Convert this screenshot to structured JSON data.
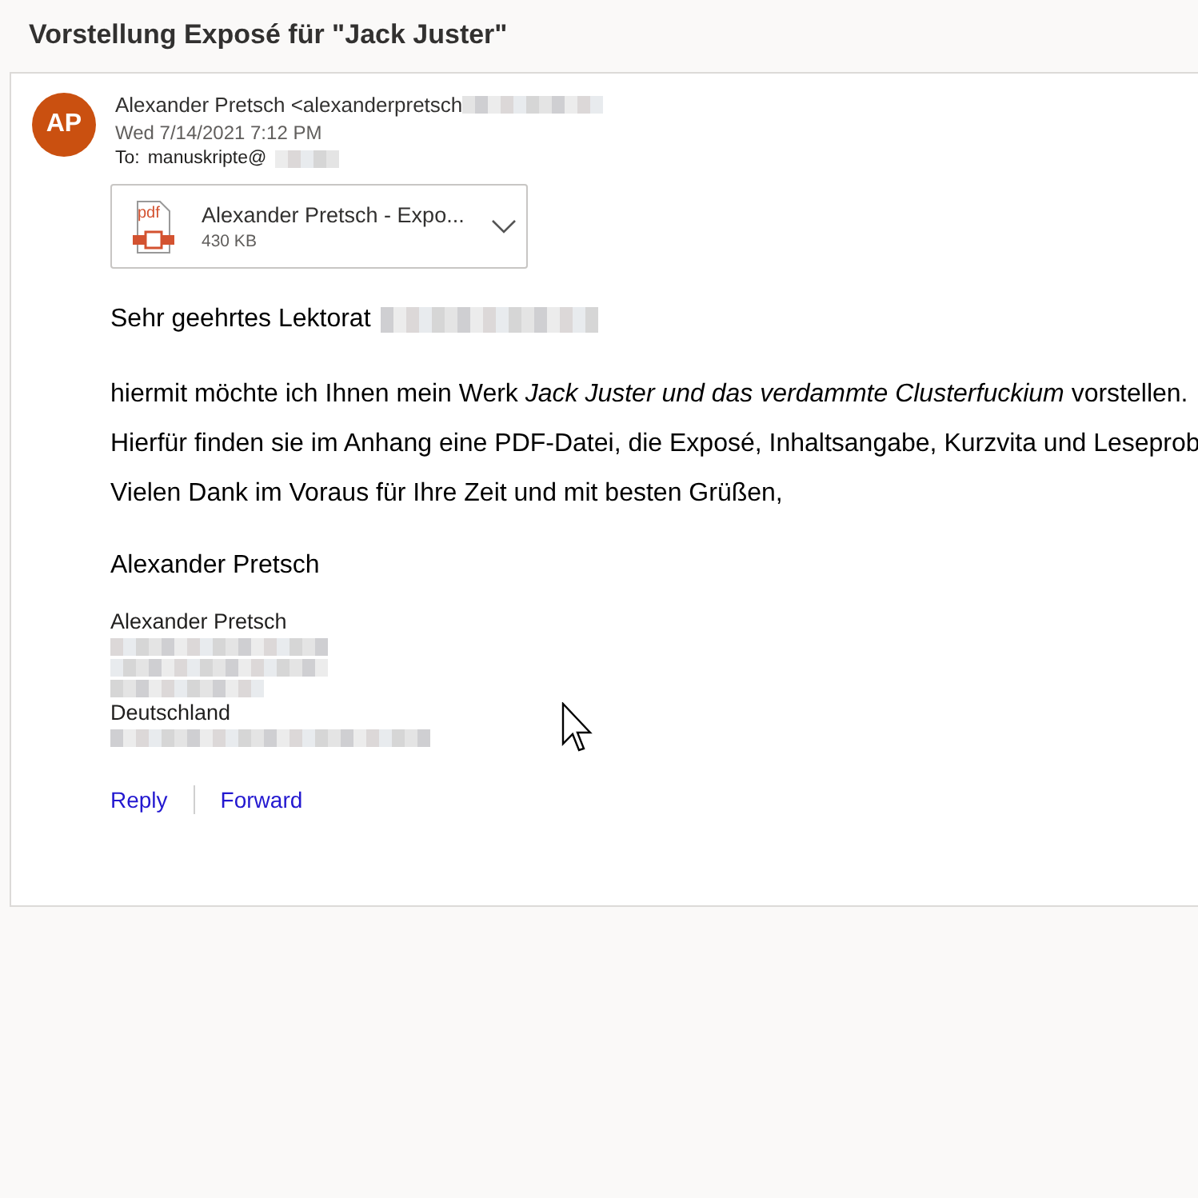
{
  "subject": "Vorstellung Exposé für \"Jack Juster\"",
  "sender": {
    "initials": "AP",
    "from": "Alexander Pretsch <alexanderpretsch",
    "date": "Wed 7/14/2021 7:12 PM",
    "to_label": "To:",
    "to": "manuskripte@"
  },
  "attachment": {
    "name": "Alexander Pretsch - Expo...",
    "size": "430 KB",
    "type_label": "pdf"
  },
  "body": {
    "greeting": "Sehr geehrtes Lektorat",
    "paragraphs": [
      "hiermit möchte ich Ihnen mein Werk *Jack Juster und das verdammte Clusterfuckium* vorstellen.",
      "Hierfür finden sie im Anhang eine PDF-Datei, die Exposé, Inhaltsangabe, Kurzvita und Leseprob",
      "Vielen Dank im Voraus für Ihre Zeit und mit besten Grüßen,"
    ],
    "closing": "Alexander Pretsch"
  },
  "signature": {
    "name": "Alexander Pretsch",
    "country": "Deutschland"
  },
  "actions": [
    "Reply",
    "Forward"
  ]
}
